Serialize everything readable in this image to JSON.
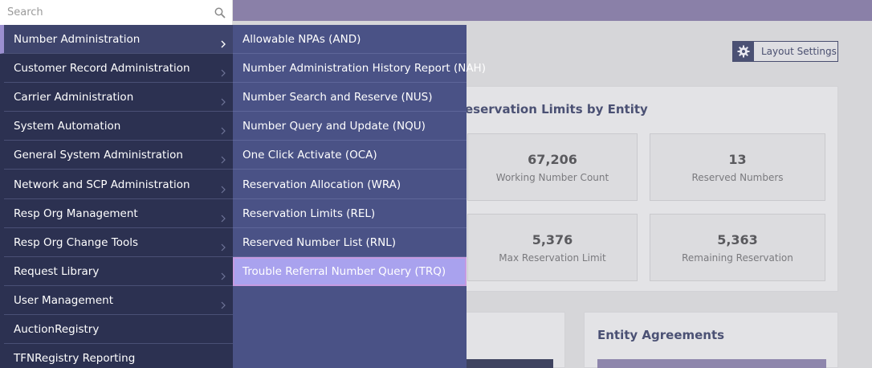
{
  "search": {
    "placeholder": "Search",
    "value": ""
  },
  "layout_button": {
    "label": "Layout Settings"
  },
  "reservation_panel": {
    "title": "eservation Limits by Entity",
    "stats": [
      {
        "value": "67,206",
        "caption": "Working Number Count"
      },
      {
        "value": "13",
        "caption": "Reserved Numbers"
      },
      {
        "value": "5,376",
        "caption": "Max Reservation Limit"
      },
      {
        "value": "5,363",
        "caption": "Remaining Reservation"
      }
    ]
  },
  "agreements_panel": {
    "title": "Entity Agreements"
  },
  "main_menu": {
    "items": [
      {
        "label": "Number Administration",
        "has_submenu": true
      },
      {
        "label": "Customer Record Administration",
        "has_submenu": true
      },
      {
        "label": "Carrier Administration",
        "has_submenu": true
      },
      {
        "label": "System Automation",
        "has_submenu": true
      },
      {
        "label": "General System Administration",
        "has_submenu": true
      },
      {
        "label": "Network and SCP Administration",
        "has_submenu": true
      },
      {
        "label": "Resp Org Management",
        "has_submenu": true
      },
      {
        "label": "Resp Org Change Tools",
        "has_submenu": true
      },
      {
        "label": "Request Library",
        "has_submenu": true
      },
      {
        "label": "User Management",
        "has_submenu": true
      },
      {
        "label": "AuctionRegistry",
        "has_submenu": false
      },
      {
        "label": "TFNRegistry Reporting",
        "has_submenu": false
      }
    ]
  },
  "sub_menu": {
    "items": [
      {
        "label": "Allowable NPAs (AND)"
      },
      {
        "label": "Number Administration History Report (NAH)"
      },
      {
        "label": "Number Search and Reserve (NUS)"
      },
      {
        "label": "Number Query and Update (NQU)"
      },
      {
        "label": "One Click Activate (OCA)"
      },
      {
        "label": "Reservation Allocation (WRA)"
      },
      {
        "label": "Reservation Limits (REL)"
      },
      {
        "label": "Reserved Number List (RNL)"
      },
      {
        "label": "Trouble Referral Number Query (TRQ)"
      }
    ]
  },
  "colors": {
    "menu_bg": "#2c3151",
    "submenu_bg": "#4a5286",
    "highlight": "#a9a2ee",
    "topbar": "#8a80a8"
  }
}
